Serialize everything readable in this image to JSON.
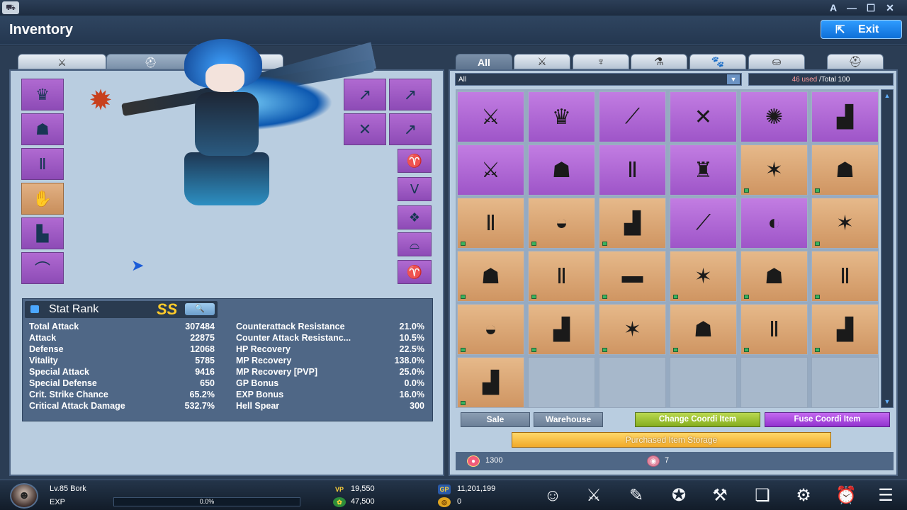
{
  "window": {
    "minimize_label": "—",
    "maximize_label": "☐",
    "close_label": "✕",
    "font_label": "A"
  },
  "header": {
    "title": "Inventory",
    "exit_label": "Exit"
  },
  "left_tabs": [
    {
      "icon": "crossed-swords-icon",
      "glyph": "⚔"
    },
    {
      "icon": "armor-icon",
      "glyph": "⛑"
    },
    {
      "icon": "paw-icon",
      "glyph": "🐾"
    }
  ],
  "equip_left": [
    {
      "icon": "hair-icon",
      "glyph": "♛",
      "tone": "purple"
    },
    {
      "icon": "top-armor-icon",
      "glyph": "☗",
      "tone": "purple"
    },
    {
      "icon": "pants-icon",
      "glyph": "Ⅱ",
      "tone": "purple"
    },
    {
      "icon": "gloves-icon",
      "glyph": "✋",
      "tone": "orange"
    },
    {
      "icon": "boots-icon",
      "glyph": "▙",
      "tone": "purple"
    },
    {
      "icon": "necklace-icon",
      "glyph": "⌒",
      "tone": "purple"
    }
  ],
  "equip_right_top": [
    {
      "icon": "spear-icon",
      "glyph": "↗"
    },
    {
      "icon": "spear-icon",
      "glyph": "↗"
    },
    {
      "icon": "crossed-spears-icon",
      "glyph": "✕"
    },
    {
      "icon": "spear-icon",
      "glyph": "↗"
    }
  ],
  "equip_right_col": [
    {
      "icon": "horns-icon",
      "glyph": "♈"
    },
    {
      "icon": "whiskers-icon",
      "glyph": "ᐯ"
    },
    {
      "icon": "wings-icon",
      "glyph": "❖"
    },
    {
      "icon": "shoes-icon",
      "glyph": "⌓"
    },
    {
      "icon": "horns-icon",
      "glyph": "♈"
    }
  ],
  "stats": {
    "title": "Stat Rank",
    "grade": "SS",
    "search_glyph": "🔍",
    "left": [
      {
        "label": "Total Attack",
        "value": "307484"
      },
      {
        "label": "Attack",
        "value": "22875"
      },
      {
        "label": "Defense",
        "value": "12068"
      },
      {
        "label": "Vitality",
        "value": "5785"
      },
      {
        "label": "Special Attack",
        "value": "9416"
      },
      {
        "label": "Special Defense",
        "value": "650"
      },
      {
        "label": "Crit. Strike Chance",
        "value": "65.2%"
      },
      {
        "label": "Critical Attack Damage",
        "value": "532.7%"
      }
    ],
    "right": [
      {
        "label": "Counterattack Resistance",
        "value": "21.0%"
      },
      {
        "label": "Counter Attack Resistanc...",
        "value": "10.5%"
      },
      {
        "label": "HP Recovery",
        "value": "22.5%"
      },
      {
        "label": "MP Recovery",
        "value": "138.0%"
      },
      {
        "label": "MP Recovery [PVP]",
        "value": "25.0%"
      },
      {
        "label": "GP Bonus",
        "value": "0.0%"
      },
      {
        "label": "EXP Bonus",
        "value": "16.0%"
      },
      {
        "label": "Hell Spear",
        "value": "300"
      }
    ]
  },
  "right_tabs": [
    {
      "label": "All",
      "glyph": ""
    },
    {
      "label": "",
      "glyph": "⚔"
    },
    {
      "label": "",
      "glyph": "♆"
    },
    {
      "label": "",
      "glyph": "⚗"
    },
    {
      "label": "",
      "glyph": "🐾"
    },
    {
      "label": "",
      "glyph": "⛀"
    },
    {
      "label": "",
      "glyph": "⛑"
    }
  ],
  "filter": {
    "value": "All",
    "arrow": "▼"
  },
  "capacity": {
    "used": "46 used",
    "total": " /Total 100"
  },
  "items": [
    {
      "glyph": "⚔",
      "tone": "purple",
      "mark": false,
      "icon": "sword-icon"
    },
    {
      "glyph": "♛",
      "tone": "purple",
      "mark": false,
      "icon": "crown-icon"
    },
    {
      "glyph": "⟋",
      "tone": "purple",
      "mark": false,
      "icon": "spear-icon"
    },
    {
      "glyph": "✕",
      "tone": "purple",
      "mark": false,
      "icon": "crossed-spears-icon"
    },
    {
      "glyph": "✺",
      "tone": "purple",
      "mark": false,
      "icon": "ring-icon"
    },
    {
      "glyph": "▟",
      "tone": "purple",
      "mark": false,
      "icon": "boots-icon"
    },
    {
      "glyph": "⚔",
      "tone": "purple",
      "mark": false,
      "icon": "sword-icon"
    },
    {
      "glyph": "☗",
      "tone": "purple",
      "mark": false,
      "icon": "armor-icon"
    },
    {
      "glyph": "Ⅱ",
      "tone": "purple",
      "mark": false,
      "icon": "pants-icon"
    },
    {
      "glyph": "♜",
      "tone": "purple",
      "mark": false,
      "icon": "helmet-icon"
    },
    {
      "glyph": "✶",
      "tone": "orange",
      "mark": true,
      "icon": "hair-icon"
    },
    {
      "glyph": "☗",
      "tone": "orange",
      "mark": true,
      "icon": "armor-icon"
    },
    {
      "glyph": "Ⅱ",
      "tone": "orange",
      "mark": true,
      "icon": "boots-icon"
    },
    {
      "glyph": "◒",
      "tone": "orange",
      "mark": true,
      "icon": "gloves-icon"
    },
    {
      "glyph": "▟",
      "tone": "orange",
      "mark": true,
      "icon": "shoes-icon"
    },
    {
      "glyph": "⟋",
      "tone": "purple",
      "mark": false,
      "icon": "rifle-icon"
    },
    {
      "glyph": "◐",
      "tone": "purple",
      "mark": false,
      "icon": "whistle-icon"
    },
    {
      "glyph": "✶",
      "tone": "orange",
      "mark": true,
      "icon": "hair-icon"
    },
    {
      "glyph": "☗",
      "tone": "orange",
      "mark": true,
      "icon": "jacket-icon"
    },
    {
      "glyph": "Ⅱ",
      "tone": "orange",
      "mark": true,
      "icon": "pants-icon"
    },
    {
      "glyph": "▬",
      "tone": "orange",
      "mark": true,
      "icon": "shoes-icon"
    },
    {
      "glyph": "✶",
      "tone": "orange",
      "mark": true,
      "icon": "hair-icon"
    },
    {
      "glyph": "☗",
      "tone": "orange",
      "mark": true,
      "icon": "armor-icon"
    },
    {
      "glyph": "Ⅱ",
      "tone": "orange",
      "mark": true,
      "icon": "pants-icon"
    },
    {
      "glyph": "◒",
      "tone": "orange",
      "mark": true,
      "icon": "gloves-icon"
    },
    {
      "glyph": "▟",
      "tone": "orange",
      "mark": true,
      "icon": "shoes-icon"
    },
    {
      "glyph": "✶",
      "tone": "orange",
      "mark": true,
      "icon": "hair-icon"
    },
    {
      "glyph": "☗",
      "tone": "orange",
      "mark": true,
      "icon": "armor-icon"
    },
    {
      "glyph": "Ⅱ",
      "tone": "orange",
      "mark": true,
      "icon": "pants-icon"
    },
    {
      "glyph": "▟",
      "tone": "orange",
      "mark": true,
      "icon": "boots-icon"
    },
    {
      "glyph": "▟",
      "tone": "orange",
      "mark": true,
      "icon": "shoes-icon"
    },
    {
      "glyph": "",
      "tone": "empty",
      "mark": false,
      "icon": "empty-slot"
    },
    {
      "glyph": "",
      "tone": "empty",
      "mark": false,
      "icon": "empty-slot"
    },
    {
      "glyph": "",
      "tone": "empty",
      "mark": false,
      "icon": "empty-slot"
    },
    {
      "glyph": "",
      "tone": "empty",
      "mark": false,
      "icon": "empty-slot"
    },
    {
      "glyph": "",
      "tone": "empty",
      "mark": false,
      "icon": "empty-slot"
    }
  ],
  "actions": {
    "sale": "Sale",
    "warehouse": "Warehouse",
    "change_coordi": "Change Coordi Item",
    "fuse_coordi": "Fuse Coordi Item",
    "storage": "Purchased Item Storage"
  },
  "currency": {
    "gem_value": "1300",
    "token_value": "7"
  },
  "player": {
    "name": "Lv.85 Bork",
    "exp_label": "EXP",
    "exp_value": "0.0%",
    "exp_fraction": 0.0,
    "vp_label": "VP",
    "vp_value": "19,550",
    "gp_label": "GP",
    "gp_value": "11,201,199",
    "gold_value": "47,500",
    "coin_value": "0"
  },
  "menu": [
    {
      "icon": "character-icon",
      "glyph": "☺"
    },
    {
      "icon": "skill-icon",
      "glyph": "⚔"
    },
    {
      "icon": "mission-icon",
      "glyph": "✎"
    },
    {
      "icon": "gift-icon",
      "glyph": "✪"
    },
    {
      "icon": "forge-icon",
      "glyph": "⚒"
    },
    {
      "icon": "book-icon",
      "glyph": "❏"
    },
    {
      "icon": "guild-icon",
      "glyph": "⚙"
    },
    {
      "icon": "alarm-icon",
      "glyph": "⏰"
    },
    {
      "icon": "menu-icon",
      "glyph": "☰"
    }
  ],
  "colors": {
    "accent": "#0e6fd8",
    "slot_purple": "#9e55c8",
    "slot_orange": "#cf9562",
    "grade_gold": "#ffcb2a"
  }
}
